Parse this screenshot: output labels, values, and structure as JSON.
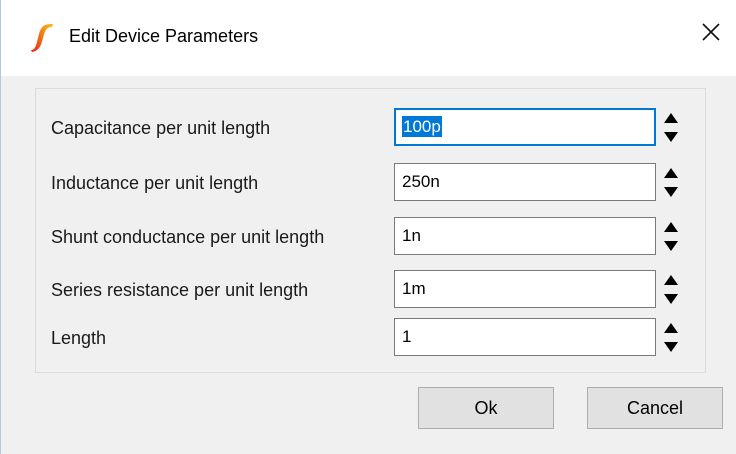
{
  "dialog": {
    "title": "Edit Device Parameters",
    "close_glyph": "✕",
    "app_icon": "simetrix-logo-icon",
    "accent_color": "#0078d7"
  },
  "params": [
    {
      "label": "Capacitance per unit length",
      "value": "100p",
      "focused": true
    },
    {
      "label": "Inductance per unit length",
      "value": "250n",
      "focused": false
    },
    {
      "label": "Shunt conductance per unit length",
      "value": "1n",
      "focused": false
    },
    {
      "label": "Series resistance per unit length",
      "value": "1m",
      "focused": false
    },
    {
      "label": "Length",
      "value": "1",
      "focused": false
    }
  ],
  "buttons": {
    "ok_label": "Ok",
    "cancel_label": "Cancel"
  }
}
